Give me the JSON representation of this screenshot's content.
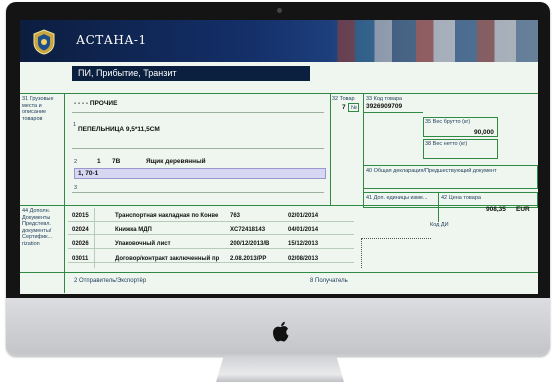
{
  "window": {
    "app_title": "АСТАНА-1",
    "form_title": "ПИ, Прибытие, Транзит"
  },
  "colors": {
    "header": "#0c1d3f",
    "form_bg": "#eef6ef",
    "border": "#2f8a43",
    "highlight": "#d7d6f3"
  },
  "box31": {
    "label": "31 Грузовые места и описание товаров",
    "category": "- - - - ПРОЧИЕ",
    "line1_num": "1",
    "line1_text": "ПЕПЕЛЬНИЦА 9,5*11,5СМ",
    "line2_num": "2",
    "line2_places": "1",
    "line2_code": "7В",
    "line2_pack": "Ящик деревянный",
    "line2_marks": "1, 70-1",
    "line3_num": "3"
  },
  "box32": {
    "label": "32 Товар",
    "value": "7",
    "no_label": "№"
  },
  "box33": {
    "label": "33 Код товара",
    "value": "3926909709"
  },
  "box35": {
    "label": "35 Вес брутто (кг)",
    "value": "90,000"
  },
  "box38": {
    "label": "38 Вес нетто (кг)",
    "value": ""
  },
  "box40": {
    "label": "40 Общая декларация/Предшествующий документ"
  },
  "box41": {
    "label": "41 Доп. единицы изме..."
  },
  "box42": {
    "label": "42 Цена товара",
    "value": "908,35",
    "currency": "EUR"
  },
  "code_di": {
    "label": "Код ДИ"
  },
  "box44": {
    "label": "44 Дополн. Документы Предстевл. документы/ Сертифик... rization",
    "rows": [
      {
        "code": "02015",
        "name": "Транспортная накладная по Конве",
        "number": "763",
        "date": "02/01/2014"
      },
      {
        "code": "02024",
        "name": "Книжка МДП",
        "number": "XC72418143",
        "date": "04/01/2014"
      },
      {
        "code": "02026",
        "name": "Упаковочный лист",
        "number": "200/12/2013/В",
        "date": "15/12/2013"
      },
      {
        "code": "03011",
        "name": "Договор/контракт заключенный пр",
        "number": "2.08.2013/PP",
        "date": "02/08/2013"
      }
    ]
  },
  "footer": {
    "sender_label": "2 Отправитель/Экспортёр",
    "receiver_label": "8 Получатель"
  }
}
